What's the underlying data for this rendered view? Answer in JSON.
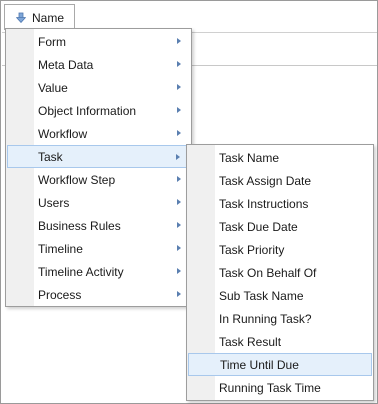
{
  "header": {
    "sort_icon": "sort-down-arrow-icon",
    "label": "Name"
  },
  "menu": {
    "items": [
      {
        "label": "Form",
        "submenu": true
      },
      {
        "label": "Meta Data",
        "submenu": true
      },
      {
        "label": "Value",
        "submenu": true
      },
      {
        "label": "Object Information",
        "submenu": true
      },
      {
        "label": "Workflow",
        "submenu": true
      },
      {
        "label": "Task",
        "submenu": true,
        "highlighted": true
      },
      {
        "label": "Workflow Step",
        "submenu": true
      },
      {
        "label": "Users",
        "submenu": true
      },
      {
        "label": "Business Rules",
        "submenu": true
      },
      {
        "label": "Timeline",
        "submenu": true
      },
      {
        "label": "Timeline Activity",
        "submenu": true
      },
      {
        "label": "Process",
        "submenu": true
      }
    ]
  },
  "submenu": {
    "items": [
      {
        "label": "Task Name"
      },
      {
        "label": "Task Assign Date"
      },
      {
        "label": "Task Instructions"
      },
      {
        "label": "Task Due Date"
      },
      {
        "label": "Task Priority"
      },
      {
        "label": "Task On Behalf Of"
      },
      {
        "label": "Sub Task Name"
      },
      {
        "label": "In Running Task?"
      },
      {
        "label": "Task Result"
      },
      {
        "label": "Time Until Due",
        "highlighted": true
      },
      {
        "label": "Running Task Time"
      }
    ]
  },
  "colors": {
    "highlight_bg": "#e5f0fb",
    "highlight_border": "#a8c8ec",
    "gutter": "#f0f0f0",
    "arrow_blue": "#5a7fb0"
  }
}
